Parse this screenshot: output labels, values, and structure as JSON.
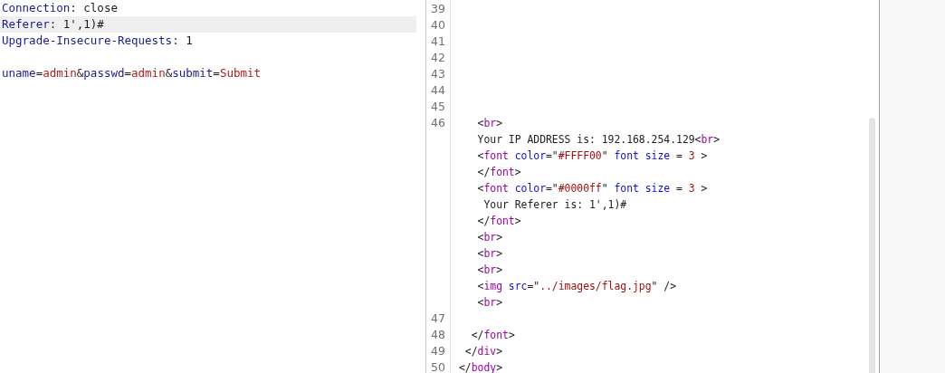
{
  "request": {
    "lines": [
      {
        "highlighted": false,
        "segments": [
          {
            "kind": "name",
            "text": "Connection"
          },
          {
            "kind": "plain",
            "text": ": close"
          }
        ]
      },
      {
        "highlighted": true,
        "segments": [
          {
            "kind": "name",
            "text": "Referer"
          },
          {
            "kind": "plain",
            "text": ": 1',1)#"
          }
        ]
      },
      {
        "highlighted": false,
        "segments": [
          {
            "kind": "name",
            "text": "Upgrade-Insecure-Requests"
          },
          {
            "kind": "plain",
            "text": ": 1"
          }
        ]
      },
      {
        "highlighted": false
      },
      {
        "highlighted": false,
        "segments": [
          {
            "kind": "name",
            "text": "uname"
          },
          {
            "kind": "plain",
            "text": "="
          },
          {
            "kind": "value",
            "text": "admin"
          },
          {
            "kind": "plain",
            "text": "&"
          },
          {
            "kind": "name",
            "text": "passwd"
          },
          {
            "kind": "plain",
            "text": "="
          },
          {
            "kind": "value",
            "text": "admin"
          },
          {
            "kind": "plain",
            "text": "&"
          },
          {
            "kind": "name",
            "text": "submit"
          },
          {
            "kind": "plain",
            "text": "="
          },
          {
            "kind": "value",
            "text": "Submit"
          }
        ]
      }
    ]
  },
  "response": {
    "lines": [
      {
        "number": "39"
      },
      {
        "number": "40"
      },
      {
        "number": "41"
      },
      {
        "number": "42"
      },
      {
        "number": "43"
      },
      {
        "number": "44"
      },
      {
        "number": "45"
      },
      {
        "number": "46",
        "segments": [
          {
            "kind": "plain",
            "text": "   <"
          },
          {
            "kind": "tag",
            "text": "br"
          },
          {
            "kind": "plain",
            "text": ">"
          }
        ]
      },
      {
        "segments": [
          {
            "kind": "plain",
            "text": "   Your IP ADDRESS is: 192.168.254.129<"
          },
          {
            "kind": "tag",
            "text": "br"
          },
          {
            "kind": "plain",
            "text": ">"
          }
        ]
      },
      {
        "segments": [
          {
            "kind": "plain",
            "text": "   <"
          },
          {
            "kind": "tag",
            "text": "font"
          },
          {
            "kind": "attr",
            "text": "color"
          },
          {
            "kind": "plain",
            "text": "=\""
          },
          {
            "kind": "value",
            "text": "#FFFF00"
          },
          {
            "kind": "plain",
            "text": "\""
          },
          {
            "kind": "attr",
            "text": "font size"
          },
          {
            "kind": "plain",
            "text": " = "
          },
          {
            "kind": "value",
            "text": "3"
          },
          {
            "kind": "plain",
            "text": " >"
          }
        ]
      },
      {
        "segments": [
          {
            "kind": "plain",
            "text": "   </"
          },
          {
            "kind": "tag",
            "text": "font"
          },
          {
            "kind": "plain",
            "text": ">"
          }
        ]
      },
      {
        "segments": [
          {
            "kind": "plain",
            "text": "   <"
          },
          {
            "kind": "tag",
            "text": "font"
          },
          {
            "kind": "attr",
            "text": "color"
          },
          {
            "kind": "plain",
            "text": "=\""
          },
          {
            "kind": "value",
            "text": "#0000ff"
          },
          {
            "kind": "plain",
            "text": "\""
          },
          {
            "kind": "attr",
            "text": "font size"
          },
          {
            "kind": "plain",
            "text": " = "
          },
          {
            "kind": "value",
            "text": "3"
          },
          {
            "kind": "plain",
            "text": " >"
          }
        ]
      },
      {
        "segments": [
          {
            "kind": "plain",
            "text": "    Your Referer is: 1',1)#"
          }
        ]
      },
      {
        "segments": [
          {
            "kind": "plain",
            "text": "   </"
          },
          {
            "kind": "tag",
            "text": "font"
          },
          {
            "kind": "plain",
            "text": ">"
          }
        ]
      },
      {
        "segments": [
          {
            "kind": "plain",
            "text": "   <"
          },
          {
            "kind": "tag",
            "text": "br"
          },
          {
            "kind": "plain",
            "text": ">"
          }
        ]
      },
      {
        "segments": [
          {
            "kind": "plain",
            "text": "   <"
          },
          {
            "kind": "tag",
            "text": "br"
          },
          {
            "kind": "plain",
            "text": ">"
          }
        ]
      },
      {
        "segments": [
          {
            "kind": "plain",
            "text": "   <"
          },
          {
            "kind": "tag",
            "text": "br"
          },
          {
            "kind": "plain",
            "text": ">"
          }
        ]
      },
      {
        "segments": [
          {
            "kind": "plain",
            "text": "   <"
          },
          {
            "kind": "tag",
            "text": "img"
          },
          {
            "kind": "attr",
            "text": "src"
          },
          {
            "kind": "plain",
            "text": "=\""
          },
          {
            "kind": "value",
            "text": "../images/flag.jpg"
          },
          {
            "kind": "plain",
            "text": "\" />"
          }
        ]
      },
      {
        "segments": [
          {
            "kind": "plain",
            "text": "   <"
          },
          {
            "kind": "tag",
            "text": "br"
          },
          {
            "kind": "plain",
            "text": ">"
          }
        ]
      },
      {
        "number": "47"
      },
      {
        "number": "48",
        "segments": [
          {
            "kind": "plain",
            "text": "  </"
          },
          {
            "kind": "tag",
            "text": "font"
          },
          {
            "kind": "plain",
            "text": ">"
          }
        ]
      },
      {
        "number": "49",
        "segments": [
          {
            "kind": "plain",
            "text": " </"
          },
          {
            "kind": "tag",
            "text": "div"
          },
          {
            "kind": "plain",
            "text": ">"
          }
        ]
      },
      {
        "number": "50",
        "segments": [
          {
            "kind": "plain",
            "text": "</"
          },
          {
            "kind": "tag",
            "text": "body"
          },
          {
            "kind": "plain",
            "text": ">"
          }
        ]
      }
    ]
  }
}
